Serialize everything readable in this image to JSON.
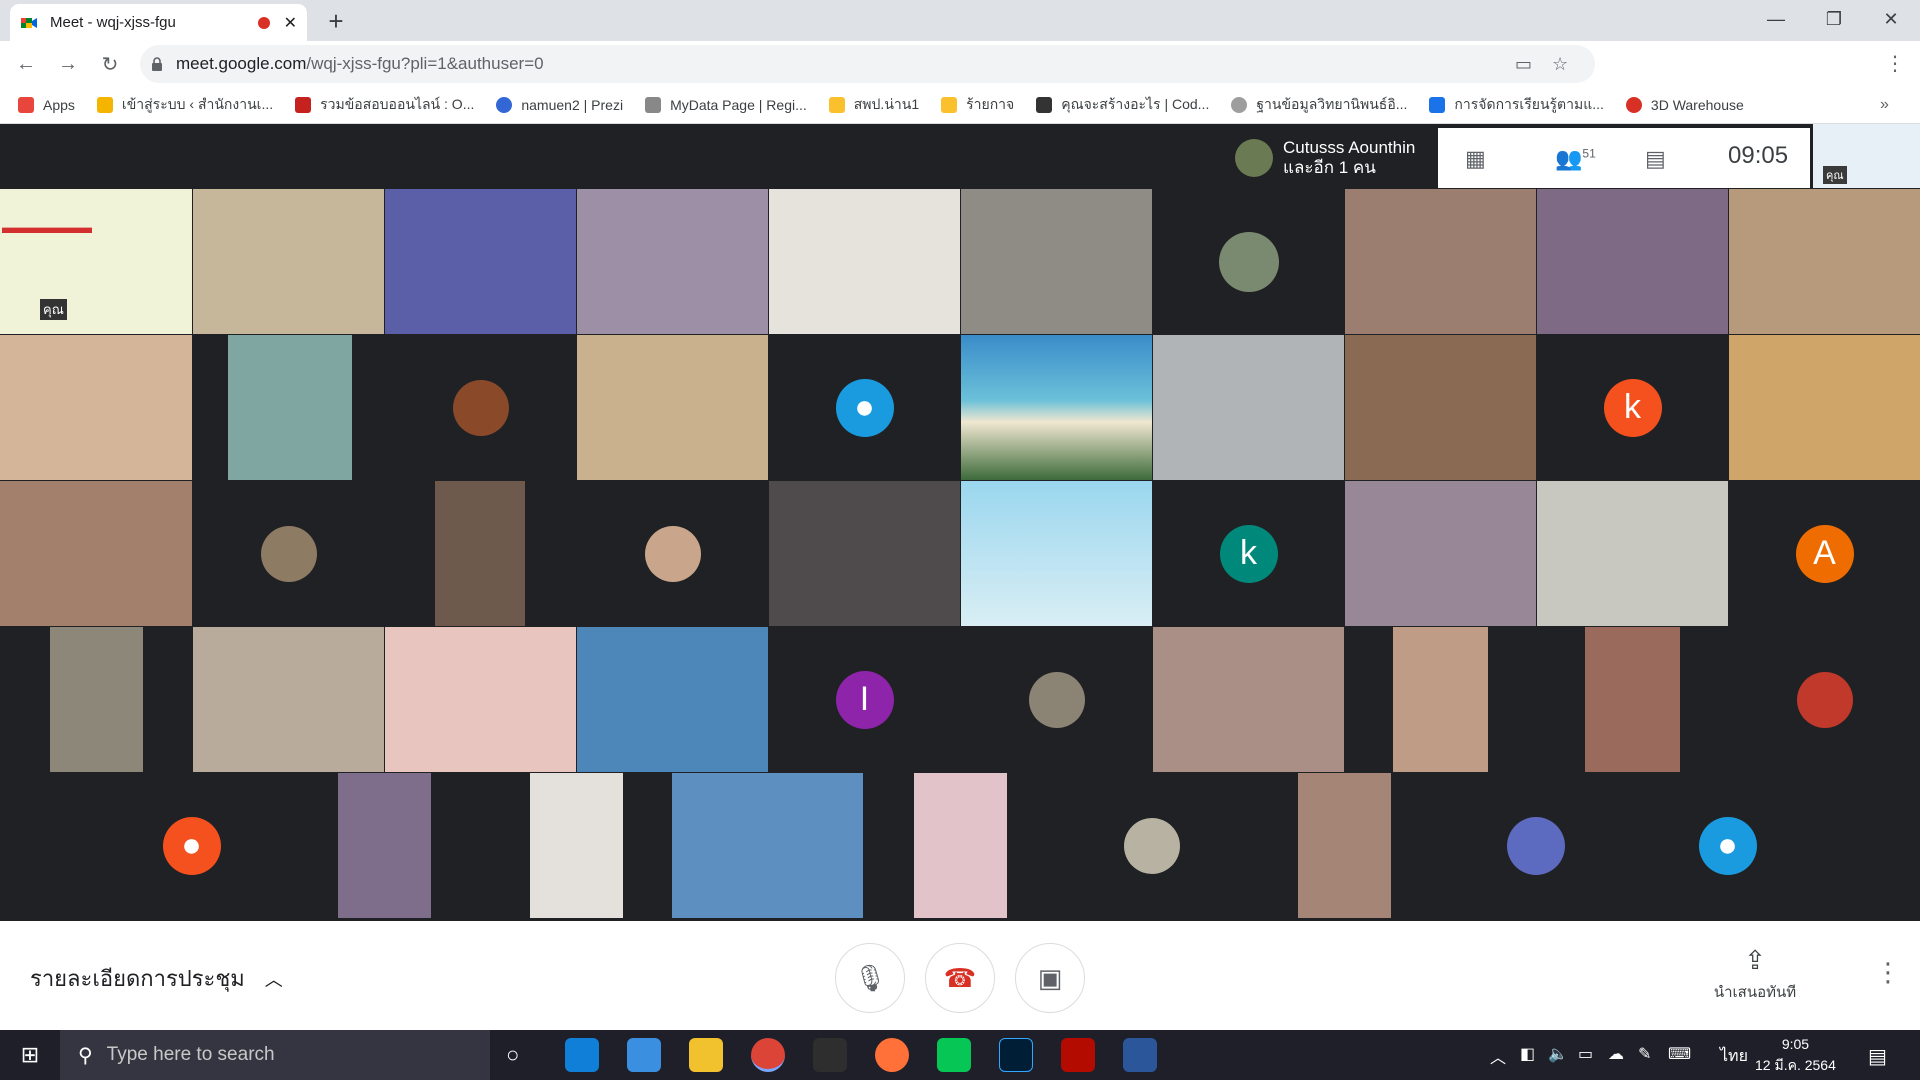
{
  "browser": {
    "tab_title": "Meet - wqj-xjss-fgu",
    "url_host": "meet.google.com",
    "url_path": "/wqj-xjss-fgu?pli=1&authuser=0",
    "bookmarks": [
      {
        "label": "Apps",
        "color": "#e8453c"
      },
      {
        "label": "เข้าสู่ระบบ ‹ สำนักงานเ...",
        "color": "#f4b400"
      },
      {
        "label": "รวมข้อสอบออนไลน์ : O...",
        "color": "#c5221f"
      },
      {
        "label": "namuen2 | Prezi",
        "color": "#3367d6"
      },
      {
        "label": "MyData Page | Regi...",
        "color": "#888888"
      },
      {
        "label": "สพป.น่าน1",
        "color": "#fbc02d"
      },
      {
        "label": "ร้ายกาจ",
        "color": "#fbc02d"
      },
      {
        "label": "คุณจะสร้างอะไร | Cod...",
        "color": "#333333"
      },
      {
        "label": "ฐานข้อมูลวิทยานิพนธ์อิ...",
        "color": "#9e9e9e"
      },
      {
        "label": "การจัดการเรียนรู้ตามแ...",
        "color": "#1a73e8"
      },
      {
        "label": "3D Warehouse",
        "color": "#d93025"
      }
    ]
  },
  "meet": {
    "presenter_name": "Cutusss Aounthin",
    "presenter_sub": "และอีก 1 คน",
    "participant_count": "51",
    "clock": "09:05",
    "self_label": "คุณ",
    "tile_self_label": "คุณ",
    "avatars": {
      "k1": "k",
      "k2": "k",
      "a": "A",
      "i": "I"
    },
    "meeting_details": "รายละเอียดการประชุม",
    "present_now": "นำเสนอทันที"
  },
  "taskbar": {
    "search_placeholder": "Type here to search",
    "time": "9:05",
    "date": "12 มี.ค. 2564",
    "lang": "ไทย"
  }
}
